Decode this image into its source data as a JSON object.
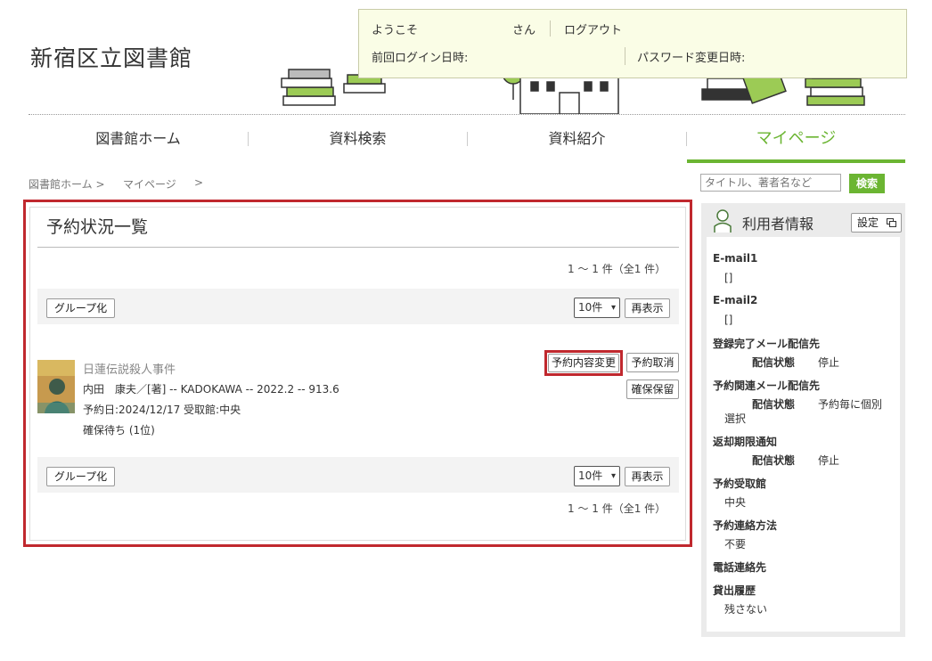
{
  "header": {
    "site_title": "新宿区立図書館",
    "welcome": "ようこそ",
    "san": "さん",
    "logout": "ログアウト",
    "last_login_label": "前回ログイン日時:",
    "password_change_label": "パスワード変更日時:"
  },
  "nav": {
    "items": [
      "図書館ホーム",
      "資料検索",
      "資料紹介",
      "マイページ"
    ],
    "active_index": 3
  },
  "breadcrumb": {
    "home": "図書館ホーム >",
    "current": "マイページ",
    "tail": ">"
  },
  "search": {
    "placeholder": "タイトル、著者名など",
    "button": "検索"
  },
  "reservation": {
    "title": "予約状況一覧",
    "count_top": "1 ～ 1 件（全1 件）",
    "count_bottom": "1 ～ 1 件（全1 件）",
    "group_button": "グループ化",
    "per_page": "10件",
    "per_page_options": [
      "10件"
    ],
    "redisplay_button": "再表示",
    "item": {
      "title": "日蓮伝説殺人事件",
      "author_line": "内田　康夫／[著] -- KADOKAWA -- 2022.2 -- 913.6",
      "reserve_line": "予約日:2024/12/17 受取館:中央",
      "status": "確保待ち (1位)",
      "change_button": "予約内容変更",
      "cancel_button": "予約取消",
      "hold_button": "確保保留"
    }
  },
  "sidebar": {
    "title": "利用者情報",
    "settings_button": "設定",
    "email1_label": "E-mail1",
    "email1_value": "[]",
    "email2_label": "E-mail2",
    "email2_value": "[]",
    "reg_mail_label": "登録完了メール配信先",
    "reg_mail_status_label": "配信状態",
    "reg_mail_status_value": "停止",
    "res_mail_label": "予約関連メール配信先",
    "res_mail_status_label": "配信状態",
    "res_mail_status_value": "予約毎に個別",
    "res_mail_status_value2": "選択",
    "due_label": "返却期限通知",
    "due_status_label": "配信状態",
    "due_status_value": "停止",
    "pickup_label": "予約受取館",
    "pickup_value": "中央",
    "contact_label": "予約連絡方法",
    "contact_value": "不要",
    "phone_label": "電話連絡先",
    "history_label": "貸出履歴",
    "history_value": "残さない"
  },
  "colors": {
    "accent_green": "#6bb532",
    "highlight_red": "#c0282e",
    "logout_orange": "#d98a12"
  },
  "icons": [
    "user-icon",
    "external-window-icon",
    "chevron-down-icon"
  ]
}
